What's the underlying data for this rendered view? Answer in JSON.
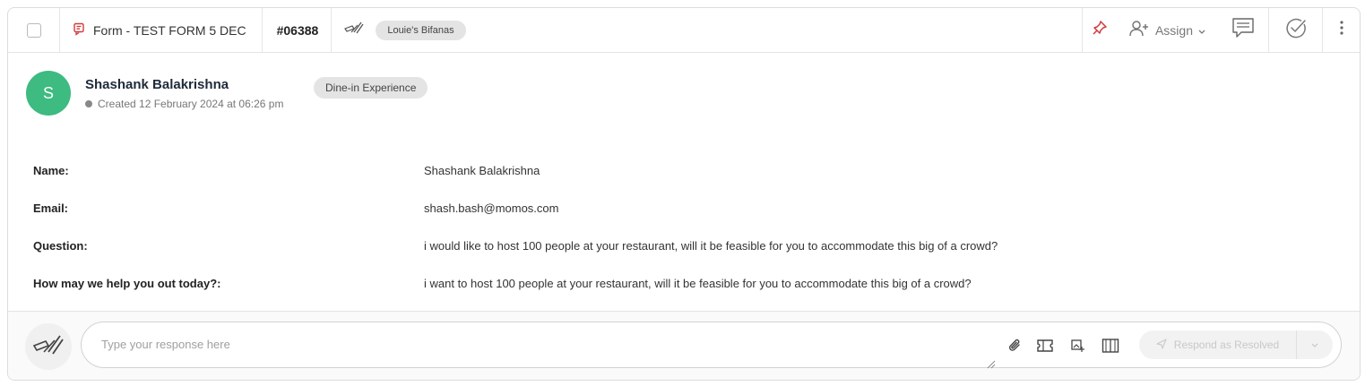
{
  "header": {
    "form_label": "Form - TEST FORM 5 DEC",
    "ticket_id": "#06388",
    "location": "Louie's Bifanas",
    "assign_label": "Assign"
  },
  "author": {
    "initial": "S",
    "name": "Shashank Balakrishna",
    "created": "Created 12 February 2024 at 06:26 pm",
    "category": "Dine-in Experience"
  },
  "fields": [
    {
      "label": "Name:",
      "value": "Shashank Balakrishna"
    },
    {
      "label": "Email:",
      "value": "shash.bash@momos.com"
    },
    {
      "label": "Question:",
      "value": "i would like to host 100 people at your restaurant, will it be feasible for you to accommodate this big of a crowd?"
    },
    {
      "label": "How may we help you out today?:",
      "value": "i want to host 100 people at your restaurant, will it be feasible for you to accommodate this big of a crowd?"
    }
  ],
  "reply": {
    "placeholder": "Type your response here",
    "resolve_label": "Respond as Resolved"
  },
  "colors": {
    "avatar": "#3dbb80",
    "pin": "#d23a3a",
    "form_icon": "#d23a3a"
  },
  "icons": [
    "form-icon",
    "shop-logo-icon",
    "pin-icon",
    "assign-user-icon",
    "chevron-down-icon",
    "comment-icon",
    "check-circle-icon",
    "more-icon",
    "clock-icon",
    "attachment-icon",
    "ticket-icon",
    "image-icon",
    "book-icon",
    "send-icon"
  ]
}
